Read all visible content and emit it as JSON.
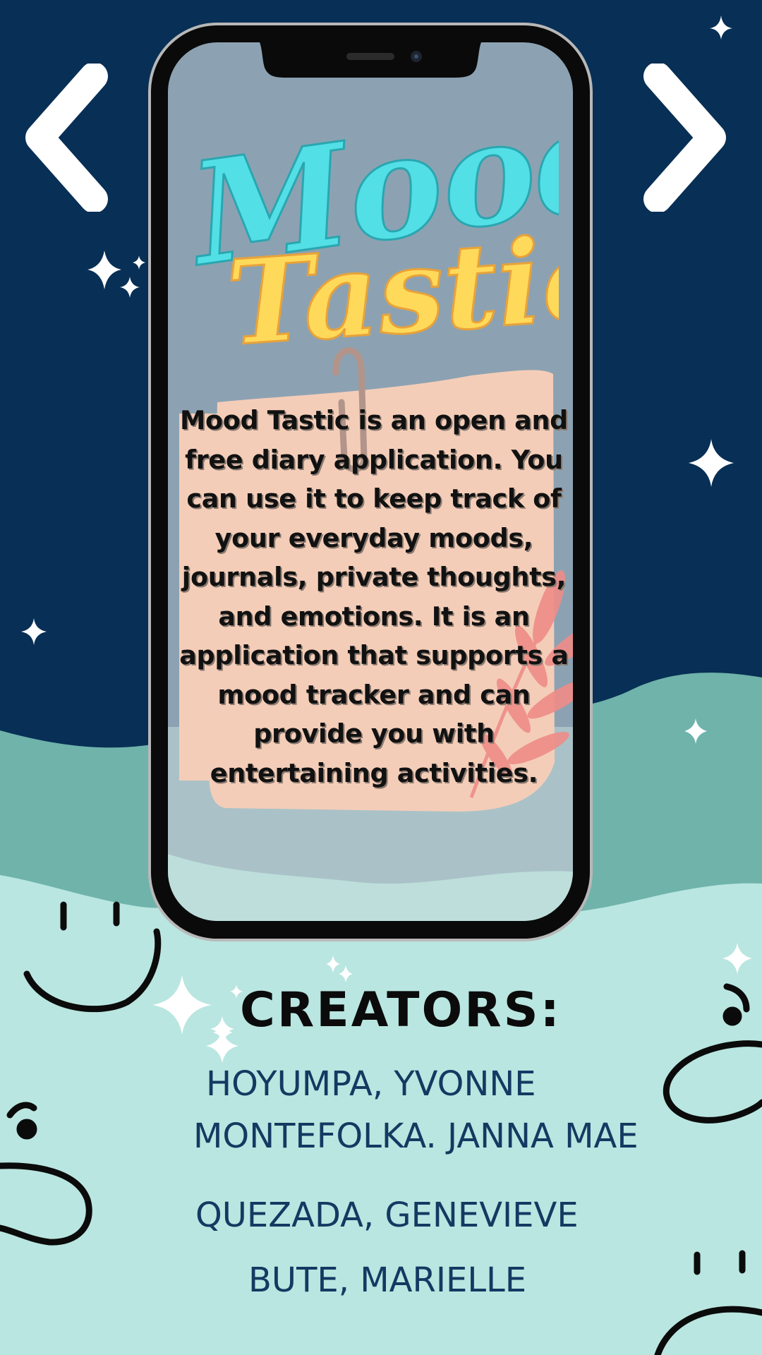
{
  "app": {
    "title_word1": "Mood",
    "title_word2": "Tastic",
    "description": "Mood Tastic is an open and free diary application. You can use it to keep track of your everyday moods, journals, private thoughts, and emotions. It is an application that supports a mood tracker and can provide you with entertaining activities."
  },
  "creators": {
    "heading": "CREATORS:",
    "names": [
      "HOYUMPA, YVONNE",
      "MONTEFOLKA. JANNA MAE",
      "QUEZADA, GENEVIEVE",
      "BUTE, MARIELLE"
    ]
  },
  "navigation": {
    "prev_icon": "chevron-left-icon",
    "next_icon": "chevron-right-icon"
  },
  "colors": {
    "night_sky": "#082f55",
    "teal_wave": "#6fb3ab",
    "mint_ground": "#b9e6e0",
    "screen_bg": "#8ca2b2",
    "logo_cyan": "#52dfe6",
    "logo_yellow": "#ffd95a",
    "note_peach": "#f4cdb8",
    "leaf_pink": "#ef8c88",
    "creator_text": "#133a62"
  }
}
